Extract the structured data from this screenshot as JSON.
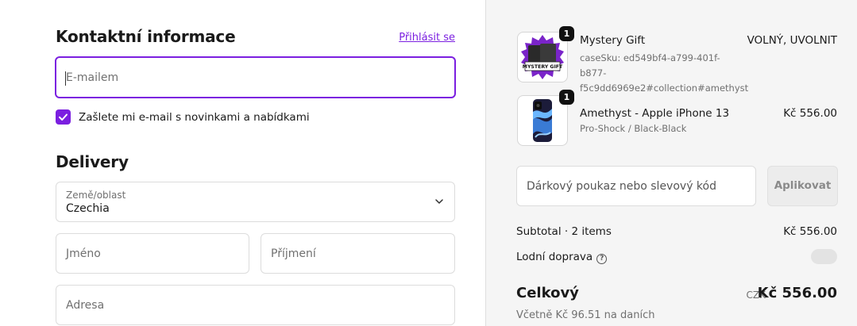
{
  "contact": {
    "title": "Kontaktní informace",
    "login_link": "Přihlásit se",
    "email_placeholder": "E-mailem",
    "newsletter_label": "Zašlete mi e-mail s novinkami a nabídkami",
    "newsletter_checked": true
  },
  "delivery": {
    "title": "Delivery",
    "country_label": "Země/oblast",
    "country_value": "Czechia",
    "first_name_placeholder": "Jméno",
    "last_name_placeholder": "Příjmení",
    "address_placeholder": "Adresa"
  },
  "summary": {
    "items": [
      {
        "title": "Mystery Gift",
        "subtitle": "caseSku: ed549bf4-a799-401f-b877-f5c9dd6969e2#collection#amethyst",
        "price": "VOLNÝ, UVOLNIT",
        "quantity": "1",
        "thumb_text": "MYSTERY GIFT"
      },
      {
        "title": "Amethyst - Apple iPhone 13",
        "subtitle": "Pro-Shock / Black-Black",
        "price": "Kč 556.00",
        "quantity": "1"
      }
    ],
    "discount_placeholder": "Dárkový poukaz nebo slevový kód",
    "apply_label": "Aplikovat",
    "subtotal_label": "Subtotal · 2 items",
    "subtotal_value": "Kč 556.00",
    "shipping_label": "Lodní doprava",
    "total_label": "Celkový",
    "total_currency": "CZK",
    "total_value": "Kč 556.00",
    "tax_note": "Včetně Kč 96.51 na daních"
  },
  "colors": {
    "accent": "#7b1fe0",
    "panel_bg": "#f5f5f5"
  },
  "icons": {
    "checkbox": "check-icon",
    "select": "chevron-down-icon",
    "help": "question-circle-icon"
  }
}
